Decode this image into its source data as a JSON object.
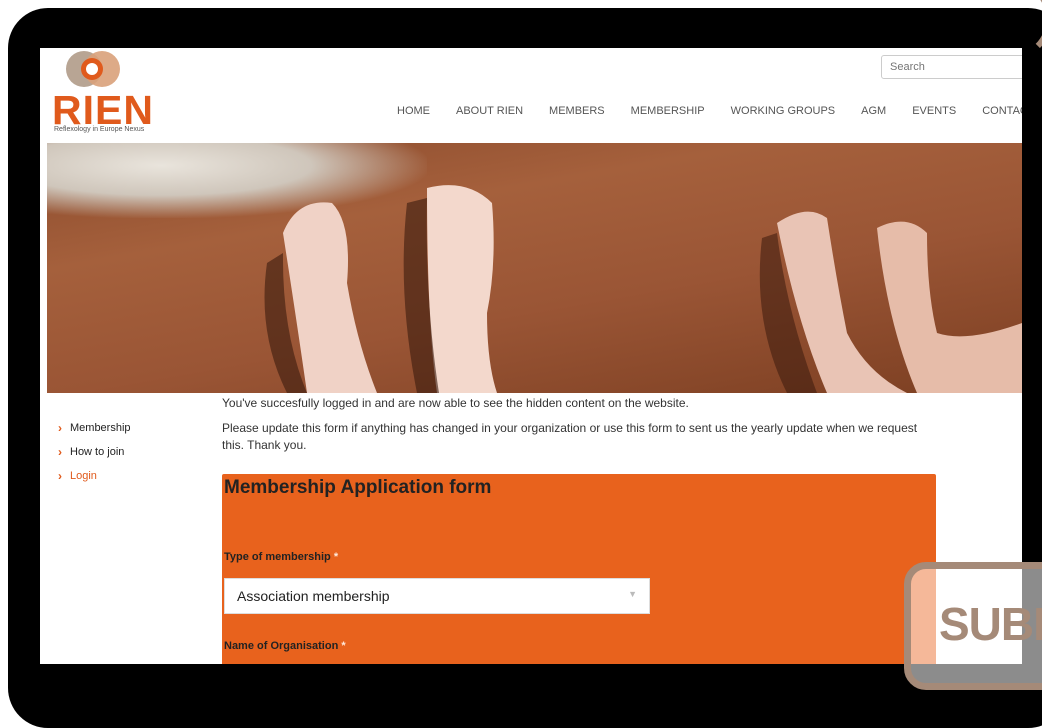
{
  "header": {
    "logo_text": "RIEN",
    "logo_tagline": "Reflexology in Europe Nexus",
    "search_placeholder": "Search"
  },
  "nav": {
    "items": [
      "HOME",
      "ABOUT RIEN",
      "MEMBERS",
      "MEMBERSHIP",
      "WORKING GROUPS",
      "AGM",
      "EVENTS",
      "CONTACT"
    ]
  },
  "sidebar": {
    "items": [
      {
        "label": "Membership",
        "active": false
      },
      {
        "label": "How to join",
        "active": false
      },
      {
        "label": "Login",
        "active": true
      }
    ]
  },
  "content": {
    "logged_in_message": "You've succesfully logged in and are now able to see the hidden content on the website.",
    "update_message": "Please update this form if anything has changed in your organization or use this form to sent us the yearly update when we request this. Thank you."
  },
  "form": {
    "title": "Membership Application form",
    "type_label": "Type of membership",
    "type_value": "Association membership",
    "org_label": "Name of Organisation",
    "required_mark": "*"
  },
  "overlay": {
    "submit_text": "SUBI"
  },
  "colors": {
    "accent": "#e8621d",
    "logo_red": "#e05a1c",
    "frame": "#000000",
    "badge": "#a58a78"
  }
}
